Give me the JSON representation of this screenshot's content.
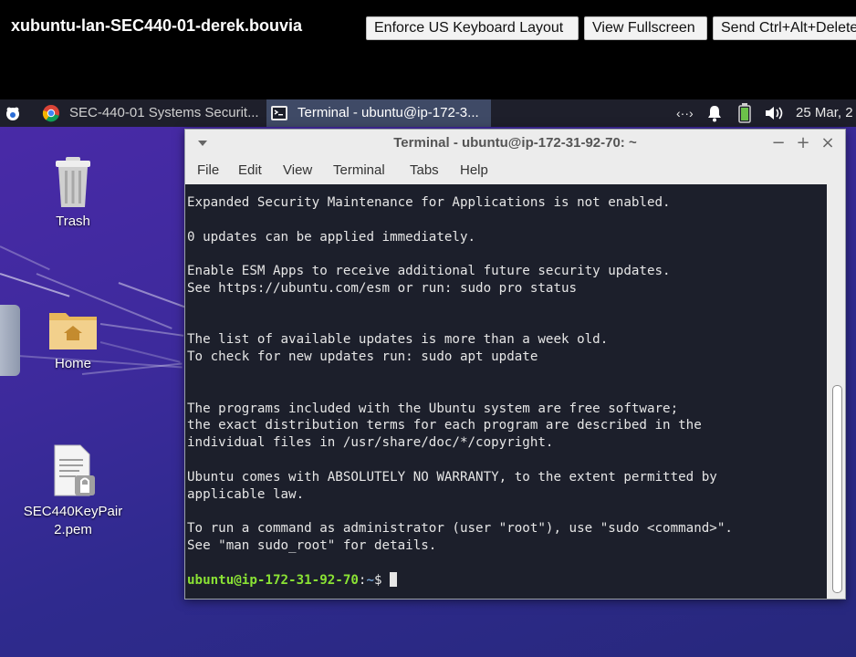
{
  "session": {
    "title": "xubuntu-lan-SEC440-01-derek.bouvia",
    "buttons": {
      "keyboard": "Enforce US Keyboard Layout",
      "fullscreen": "View Fullscreen",
      "ctrlaltdel": "Send Ctrl+Alt+Delete"
    }
  },
  "panel": {
    "tasks": [
      {
        "label": "SEC-440-01 Systems Securit...",
        "icon": "chrome-icon"
      },
      {
        "label": "Terminal - ubuntu@ip-172-3...",
        "icon": "terminal-icon"
      }
    ],
    "tray": {
      "network": "‹··›"
    },
    "clock": "25 Mar, 2"
  },
  "desktop": {
    "icons": [
      {
        "label": "Trash",
        "icon": "trash-icon"
      },
      {
        "label": "Home",
        "icon": "home-folder-icon"
      },
      {
        "label_line1": "SEC440KeyPair",
        "label_line2": "2.pem",
        "icon": "locked-file-icon"
      }
    ]
  },
  "terminal": {
    "title": "Terminal - ubuntu@ip-172-31-92-70: ~",
    "menu": [
      "File",
      "Edit",
      "View",
      "Terminal",
      "Tabs",
      "Help"
    ],
    "controls": {
      "minimize": "−",
      "maximize": "+",
      "close": "×"
    },
    "lines": [
      "Expanded Security Maintenance for Applications is not enabled.",
      "",
      "0 updates can be applied immediately.",
      "",
      "Enable ESM Apps to receive additional future security updates.",
      "See https://ubuntu.com/esm or run: sudo pro status",
      "",
      "",
      "The list of available updates is more than a week old.",
      "To check for new updates run: sudo apt update",
      "",
      "",
      "The programs included with the Ubuntu system are free software;",
      "the exact distribution terms for each program are described in the",
      "individual files in /usr/share/doc/*/copyright.",
      "",
      "Ubuntu comes with ABSOLUTELY NO WARRANTY, to the extent permitted by",
      "applicable law.",
      "",
      "To run a command as administrator (user \"root\"), use \"sudo <command>\".",
      "See \"man sudo_root\" for details.",
      ""
    ],
    "prompt": {
      "user_host": "ubuntu@ip-172-31-92-70",
      "sep": ":",
      "path": "~",
      "symbol": "$ "
    }
  }
}
